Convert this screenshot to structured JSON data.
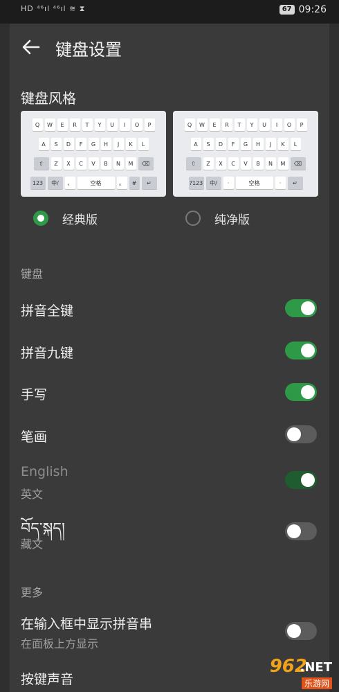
{
  "status_bar": {
    "left_icons_text": "HD ⁴⁶ıl ⁴⁶ıl ≋ ⧗",
    "battery": "67",
    "time": "09:26"
  },
  "app_bar": {
    "title": "键盘设置",
    "back_icon": "arrow-left-icon"
  },
  "keyboard_style": {
    "heading": "键盘风格",
    "row1": [
      "Q",
      "W",
      "E",
      "R",
      "T",
      "Y",
      "U",
      "I",
      "O",
      "P"
    ],
    "row2": [
      "A",
      "S",
      "D",
      "F",
      "G",
      "H",
      "J",
      "K",
      "L"
    ],
    "row3": [
      "Z",
      "X",
      "C",
      "V",
      "B",
      "N",
      "M"
    ],
    "space_label": "空格",
    "mode_label_classic": "123",
    "mode_label_pure": "?123",
    "lang_label": "中/",
    "options": [
      {
        "label": "经典版",
        "selected": true
      },
      {
        "label": "纯净版",
        "selected": false
      }
    ]
  },
  "keyboard_group": {
    "label": "键盘",
    "items": [
      {
        "label": "拼音全键",
        "on": true
      },
      {
        "label": "拼音九键",
        "on": true
      },
      {
        "label": "手写",
        "on": true
      },
      {
        "label": "笔画",
        "on": false
      },
      {
        "label": "English",
        "sub": "英文",
        "on": true,
        "disabled": true
      },
      {
        "label": "བོད་སྐད།",
        "sub": "藏文",
        "on": false
      }
    ]
  },
  "more_group": {
    "label": "更多",
    "items": [
      {
        "label": "在输入框中显示拼音串",
        "sub": "在面板上方显示",
        "on": false
      },
      {
        "label": "按键声音"
      }
    ]
  },
  "watermark": {
    "big": "962",
    "net": ".NET",
    "sub": "乐游网"
  },
  "colors": {
    "accent": "#2e9a47",
    "background": "#3a3a3a"
  }
}
